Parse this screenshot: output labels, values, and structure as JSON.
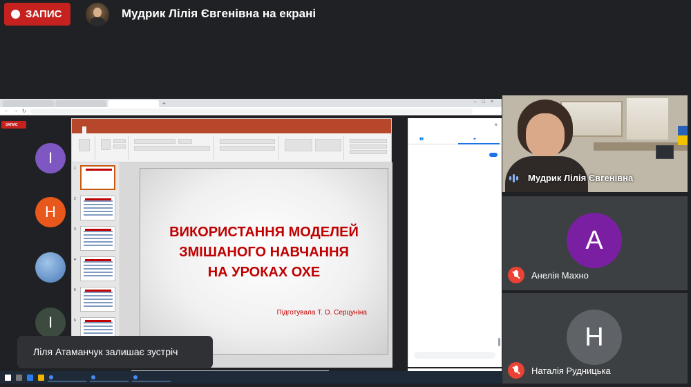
{
  "recording": {
    "label": "ЗАПИС"
  },
  "presenter": {
    "title": "Мудрик Лілія Євгенівна на екрані"
  },
  "shared_screen": {
    "mini_recording_label": "ЗАПИС",
    "browser_tabs": [
      "",
      "",
      ""
    ],
    "address": "",
    "participants_left": [
      {
        "initial": "I"
      },
      {
        "initial": "Н"
      },
      {
        "initial": ""
      },
      {
        "initial": "I"
      }
    ],
    "slide": {
      "title_lines": [
        "ВИКОРИСТАННЯ МОДЕЛЕЙ",
        "ЗМІШАНОГО НАВЧАННЯ",
        "НА УРОКАХ ОХЕ"
      ],
      "author": "Підготувала Т. О. Серцуніна"
    },
    "slide_numbers": [
      "1",
      "2",
      "3",
      "4",
      "5",
      "6"
    ]
  },
  "toast": {
    "text": "Ліля Атаманчук залишає зустріч"
  },
  "self_view": {
    "name": "Мудрик Лілія Євгенівна"
  },
  "participants": [
    {
      "initial": "A",
      "name": "Анелія Махно",
      "color": "#7b1fa2"
    },
    {
      "initial": "Н",
      "name": "Наталія Рудницька",
      "color": "#5f6368"
    }
  ]
}
